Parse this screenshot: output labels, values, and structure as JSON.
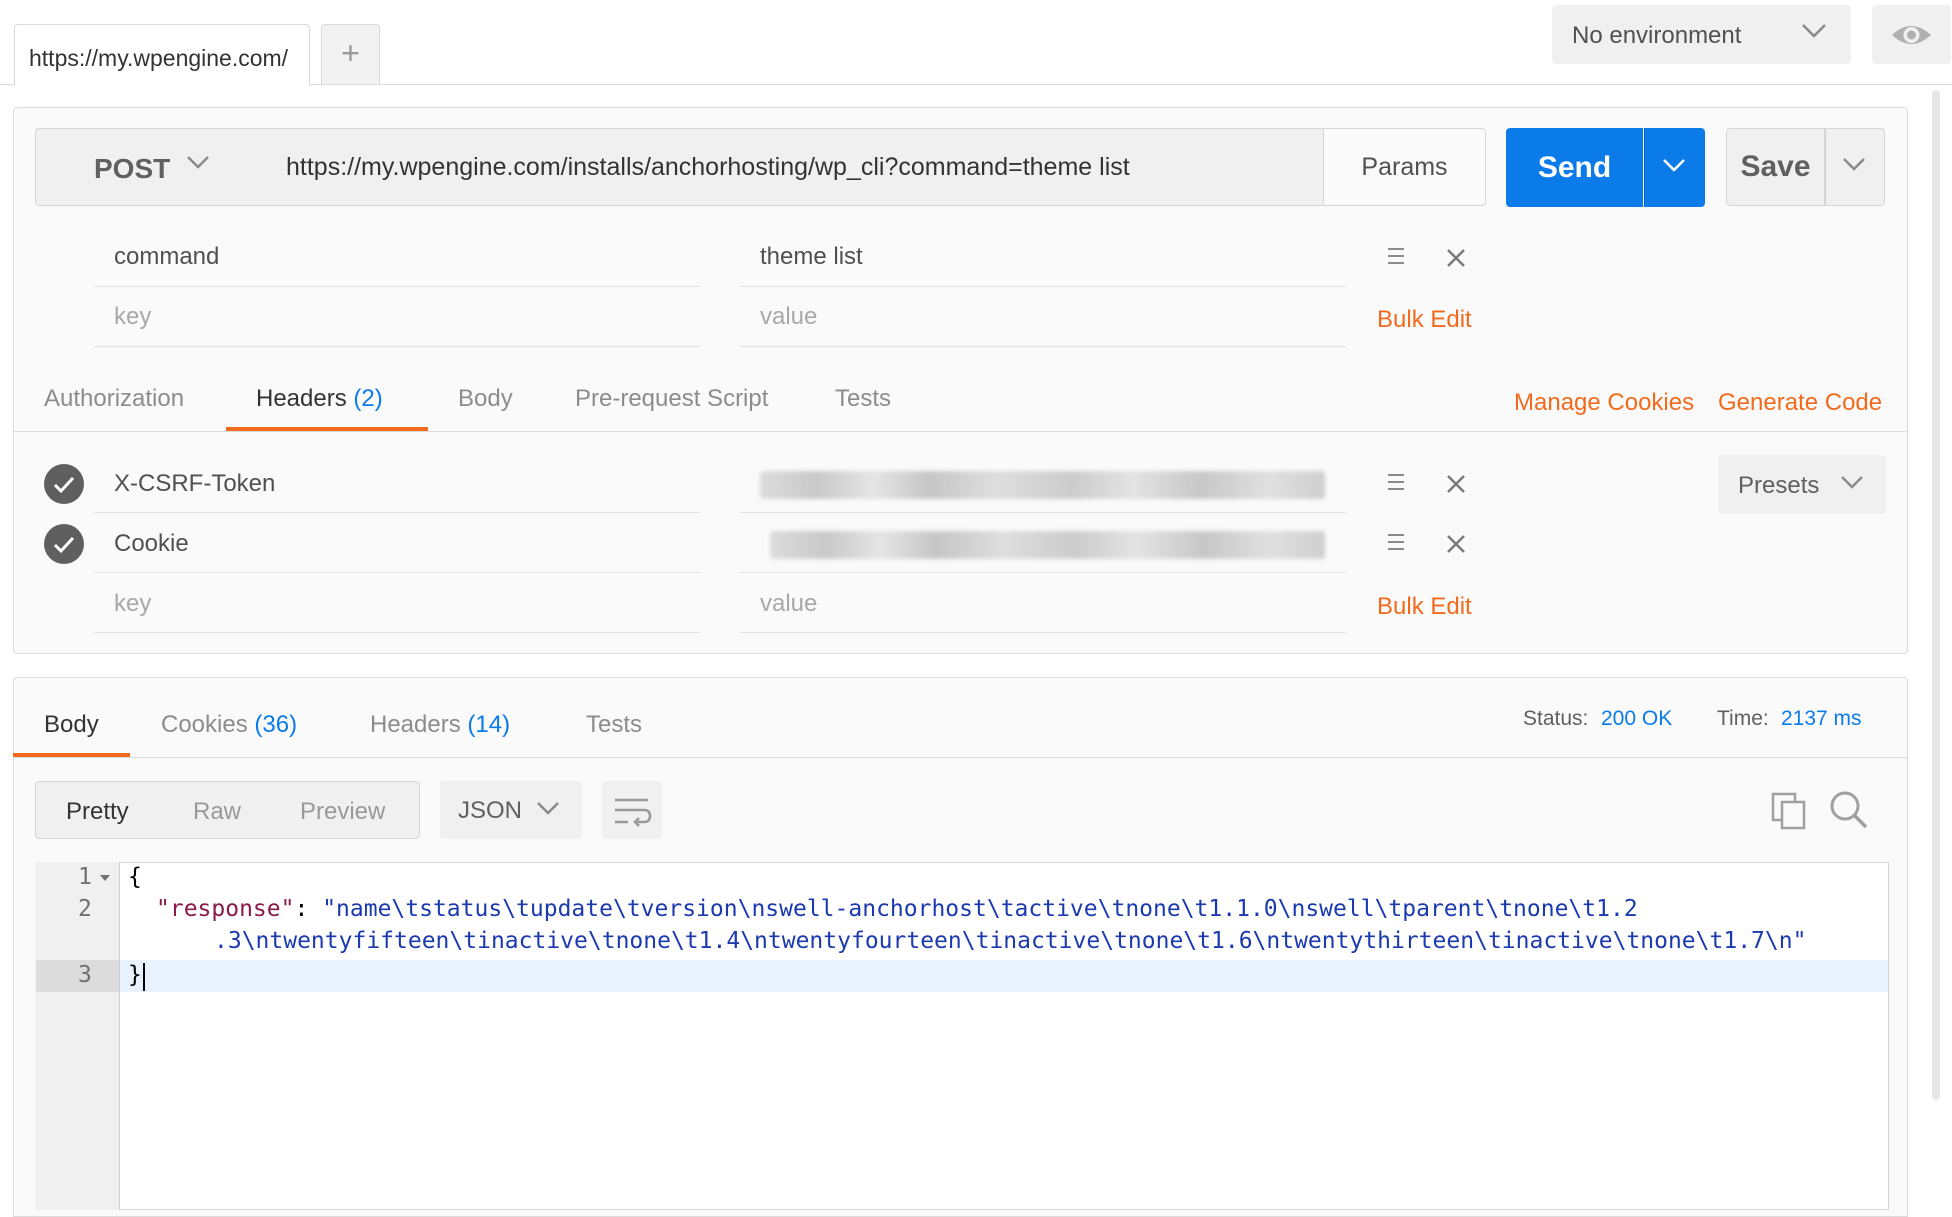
{
  "tabs": {
    "active_tab_label": "https://my.wpengine.com/",
    "add_tab_symbol": "+"
  },
  "environment": {
    "selected": "No environment"
  },
  "request": {
    "method": "POST",
    "url": "https://my.wpengine.com/installs/anchorhosting/wp_cli?command=theme list",
    "params_label": "Params",
    "send_label": "Send",
    "save_label": "Save"
  },
  "url_params": {
    "rows": [
      {
        "key": "command",
        "value": "theme list"
      }
    ],
    "key_placeholder": "key",
    "value_placeholder": "value",
    "bulk_edit_label": "Bulk Edit"
  },
  "request_tabs": {
    "authorization": "Authorization",
    "headers": "Headers",
    "headers_count": "(2)",
    "body": "Body",
    "prerequest": "Pre-request Script",
    "tests": "Tests",
    "manage_cookies": "Manage Cookies",
    "generate_code": "Generate Code"
  },
  "headers": {
    "rows": [
      {
        "key": "X-CSRF-Token",
        "value_hidden": true
      },
      {
        "key": "Cookie",
        "value_hidden": true
      }
    ],
    "key_placeholder": "key",
    "value_placeholder": "value",
    "bulk_edit_label": "Bulk Edit",
    "presets_label": "Presets"
  },
  "response_tabs": {
    "body": "Body",
    "cookies": "Cookies",
    "cookies_count": "(36)",
    "headers": "Headers",
    "headers_count": "(14)",
    "tests": "Tests"
  },
  "response_status": {
    "status_label": "Status:",
    "status_value": "200 OK",
    "time_label": "Time:",
    "time_value": "2137 ms"
  },
  "response_view": {
    "pretty": "Pretty",
    "raw": "Raw",
    "preview": "Preview",
    "language": "JSON"
  },
  "editor": {
    "line_numbers": [
      "1",
      "2",
      "3"
    ],
    "line1": "{",
    "line2_key": "\"response\"",
    "line2_colon": ": ",
    "line2_value_a": "\"name\\tstatus\\tupdate\\tversion\\nswell-anchorhost\\tactive\\tnone\\t1.1.0\\nswell\\tparent\\tnone\\t1.2",
    "line2_value_b": ".3\\ntwentyfifteen\\tinactive\\tnone\\t1.4\\ntwentyfourteen\\tinactive\\tnone\\t1.6\\ntwentythirteen\\tinactive\\tnone\\t1.7\\n\"",
    "line3": "}"
  },
  "colors": {
    "accent_blue": "#0b7bea",
    "accent_orange": "#f26b1d"
  },
  "icons": {
    "environment_dropdown": "chevron-down-icon",
    "environment_quick_look": "eye-icon",
    "row_reorder": "hamburger-icon",
    "row_delete": "close-icon",
    "header_enabled": "check-circle-icon",
    "copy": "copy-icon",
    "search": "search-icon",
    "wrap": "wrap-lines-icon"
  }
}
